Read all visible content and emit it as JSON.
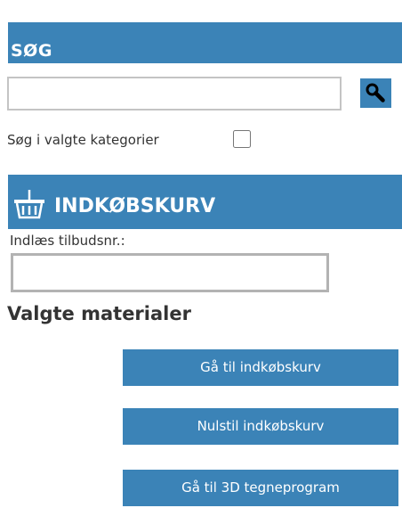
{
  "search": {
    "title": "SØG",
    "input_value": "",
    "button_icon": "search-icon",
    "category_label": "Søg i valgte kategorier",
    "category_checked": false
  },
  "cart": {
    "title": "INDKØBSKURV",
    "icon": "shopping-basket-icon",
    "offer_label": "Indlæs tilbudsnr.:",
    "offer_value": "",
    "materials_heading": "Valgte materialer",
    "buttons": {
      "goto_cart": "Gå til indkøbskurv",
      "reset_cart": "Nulstil indkøbskurv",
      "goto_3d": "Gå til 3D tegneprogram"
    }
  },
  "colors": {
    "accent": "#3b83b7",
    "header_text": "#ffffff",
    "body_text": "#333333"
  }
}
